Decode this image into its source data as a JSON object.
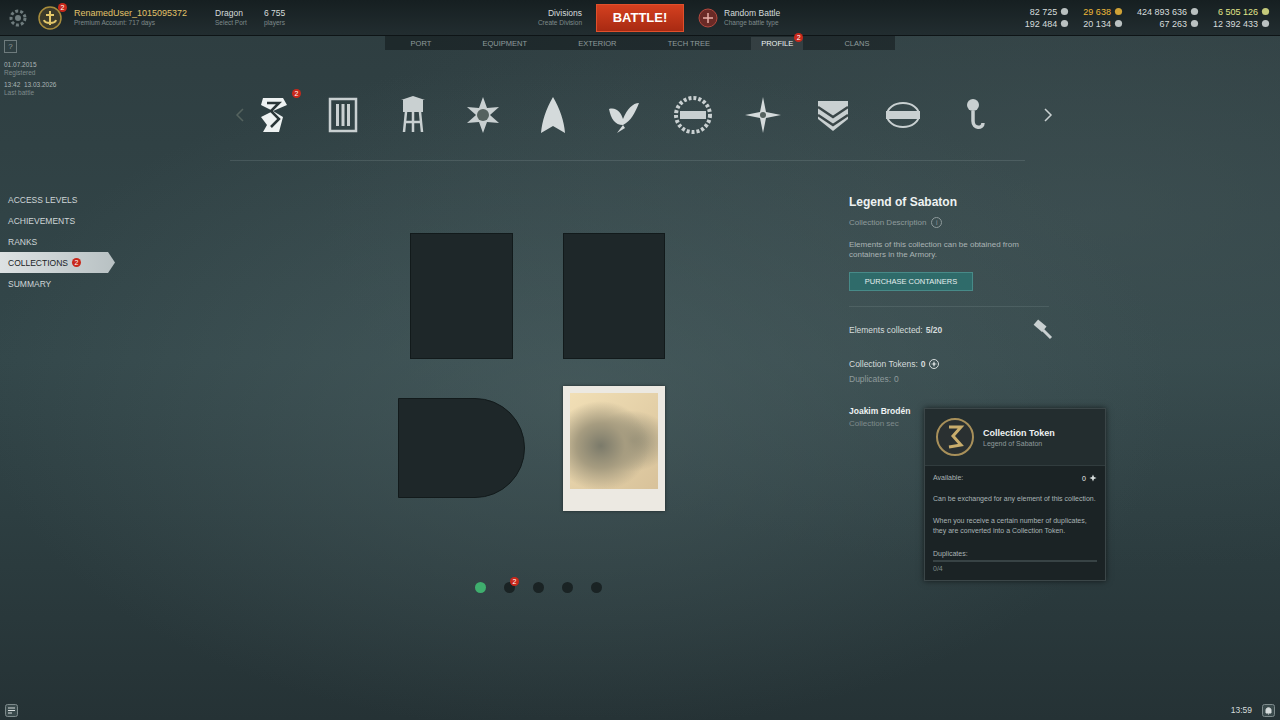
{
  "top_bar": {
    "user": {
      "badge": "2",
      "name": "RenamedUser_1015095372",
      "status": "Premium Account: 717 days"
    },
    "port": {
      "name": "Dragon",
      "action": "Select Port"
    },
    "online": {
      "count": "6 755",
      "label": "players"
    },
    "divisions": {
      "label": "Divisions",
      "action": "Create Division"
    },
    "battle_button": "BATTLE!",
    "battle_type": {
      "label": "Random Battle",
      "action": "Change battle type"
    },
    "resources": [
      {
        "value": "82 725",
        "color": "#d6dcdc"
      },
      {
        "value": "29 638",
        "color": "#f0b93a"
      },
      {
        "value": "424 893 636",
        "color": "#d6dcdc"
      },
      {
        "value": "6 505 126",
        "color": "#e2e68a"
      },
      {
        "value": "192 484",
        "color": "#d6dcdc"
      },
      {
        "value": "20 134",
        "color": "#d6dcdc"
      },
      {
        "value": "67 263",
        "color": "#d6dcdc"
      },
      {
        "value": "12 392 433",
        "color": "#d6dcdc"
      }
    ]
  },
  "nav_tabs": [
    {
      "label": "PORT",
      "selected": false
    },
    {
      "label": "EQUIPMENT",
      "selected": false
    },
    {
      "label": "EXTERIOR",
      "selected": false
    },
    {
      "label": "TECH TREE",
      "selected": false
    },
    {
      "label": "PROFILE",
      "selected": true,
      "badge": "2"
    },
    {
      "label": "CLANS",
      "selected": false
    }
  ],
  "account_info": {
    "help": "?",
    "entries": [
      {
        "value": "01.07.2015",
        "label": "Registered"
      },
      {
        "value": "13:42  13.03.2026",
        "label": "Last battle"
      }
    ]
  },
  "collections_carousel": [
    {
      "selected": true,
      "badge": "2"
    },
    {
      "selected": false
    },
    {
      "selected": false
    },
    {
      "selected": false
    },
    {
      "selected": false
    },
    {
      "selected": false
    },
    {
      "selected": false
    },
    {
      "selected": false
    },
    {
      "selected": false
    },
    {
      "selected": false
    },
    {
      "selected": false
    },
    {
      "selected": false
    }
  ],
  "side_menu": [
    {
      "label": "ACCESS LEVELS",
      "selected": false
    },
    {
      "label": "ACHIEVEMENTS",
      "selected": false
    },
    {
      "label": "RANKS",
      "selected": false
    },
    {
      "label": "COLLECTIONS",
      "selected": true,
      "badge": "2"
    },
    {
      "label": "SUMMARY",
      "selected": false
    }
  ],
  "collection": {
    "title": "Legend of Sabaton",
    "description_label": "Collection Description",
    "info": "i",
    "description": "Elements of this collection can be obtained from containers in the Armory.",
    "purchase_button": "PURCHASE CONTAINERS",
    "elements_label": "Elements collected:",
    "elements_count": "5/20",
    "tokens_label": "Collection Tokens:",
    "tokens_value": "0",
    "duplicates_label": "Duplicates:",
    "duplicates_value": "0",
    "section": {
      "title": "Joakim Brodén",
      "subtitle": "Collection sec"
    }
  },
  "elements": [
    {
      "kind": "rect",
      "collected": false
    },
    {
      "kind": "rect",
      "collected": false
    },
    {
      "kind": "rounded",
      "collected": false
    },
    {
      "kind": "photo",
      "collected": true
    }
  ],
  "pager": [
    {
      "selected": true
    },
    {
      "selected": false,
      "badge": "2"
    },
    {
      "selected": false
    },
    {
      "selected": false
    },
    {
      "selected": false
    }
  ],
  "tooltip": {
    "title": "Collection Token",
    "subtitle": "Legend of Sabaton",
    "available_label": "Available:",
    "available_value": "0",
    "text": [
      "Can be exchanged for any element of this collection.",
      "When you receive a certain number of duplicates, they are converted into a Collection Token."
    ],
    "duplicates_label": "Duplicates:",
    "duplicates_progress": "0/4",
    "level": 0
  },
  "bottom_bar": {
    "clock": "13:59"
  }
}
